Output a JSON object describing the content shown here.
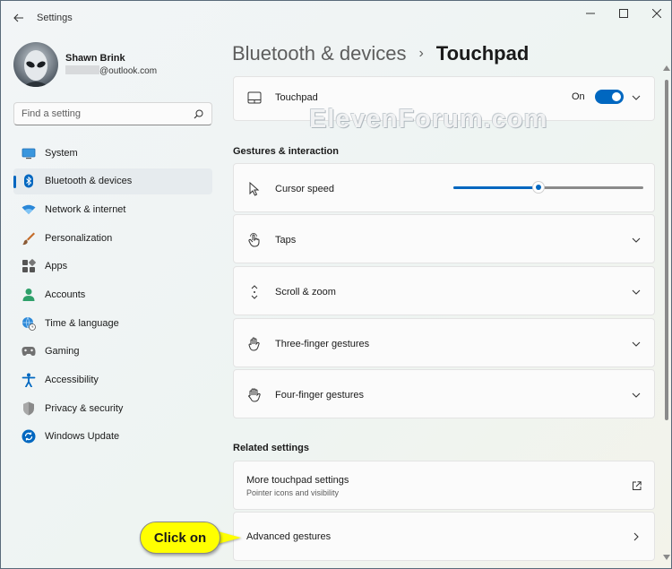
{
  "window": {
    "title": "Settings",
    "controls": {
      "minimize": "minimize-icon",
      "maximize": "maximize-icon",
      "close": "close-icon"
    }
  },
  "user": {
    "name": "Shawn Brink",
    "email_suffix": "@outlook.com"
  },
  "search": {
    "placeholder": "Find a setting"
  },
  "sidebar": {
    "items": [
      {
        "label": "System",
        "icon": "system-icon",
        "active": false
      },
      {
        "label": "Bluetooth & devices",
        "icon": "bluetooth-icon",
        "active": true
      },
      {
        "label": "Network & internet",
        "icon": "wifi-icon",
        "active": false
      },
      {
        "label": "Personalization",
        "icon": "brush-icon",
        "active": false
      },
      {
        "label": "Apps",
        "icon": "apps-icon",
        "active": false
      },
      {
        "label": "Accounts",
        "icon": "accounts-icon",
        "active": false
      },
      {
        "label": "Time & language",
        "icon": "globe-clock-icon",
        "active": false
      },
      {
        "label": "Gaming",
        "icon": "gamepad-icon",
        "active": false
      },
      {
        "label": "Accessibility",
        "icon": "accessibility-icon",
        "active": false
      },
      {
        "label": "Privacy & security",
        "icon": "shield-icon",
        "active": false
      },
      {
        "label": "Windows Update",
        "icon": "update-icon",
        "active": false
      }
    ]
  },
  "breadcrumb": {
    "parent": "Bluetooth & devices",
    "separator": "›",
    "current": "Touchpad"
  },
  "watermark": "ElevenForum.com",
  "touchpad": {
    "label": "Touchpad",
    "state": "On",
    "enabled": true
  },
  "gestures_section": {
    "title": "Gestures & interaction",
    "cursor_speed": {
      "label": "Cursor speed",
      "value_fraction": 0.45
    },
    "taps": "Taps",
    "scroll_zoom": "Scroll & zoom",
    "three_finger": "Three-finger gestures",
    "four_finger": "Four-finger gestures"
  },
  "related_section": {
    "title": "Related settings",
    "more_touchpad": {
      "label": "More touchpad settings",
      "sublabel": "Pointer icons and visibility"
    },
    "advanced_gestures": {
      "label": "Advanced gestures"
    }
  },
  "callout": "Click on",
  "colors": {
    "accent": "#0067c0",
    "callout": "#ffff00"
  }
}
